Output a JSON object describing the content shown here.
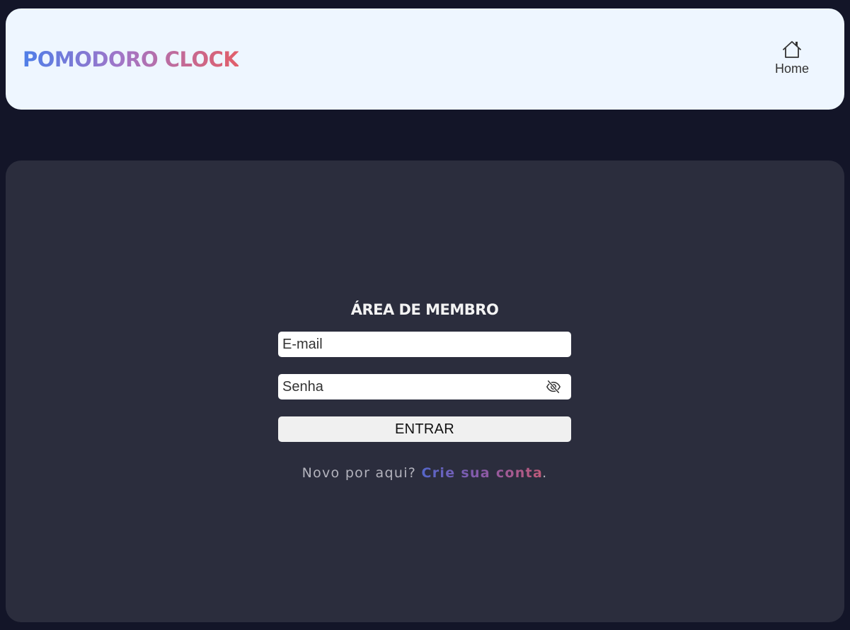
{
  "header": {
    "logo_text": "POMODORO CLOCK",
    "nav": {
      "home_label": "Home",
      "home_icon": "home-icon"
    }
  },
  "login": {
    "title": "ÁREA DE MEMBRO",
    "email_placeholder": "E-mail",
    "password_placeholder": "Senha",
    "password_toggle_icon": "eye-off-icon",
    "submit_label": "ENTRAR",
    "signup_prompt": "Novo por aqui?",
    "signup_link": "Crie sua conta",
    "signup_suffix": "."
  },
  "colors": {
    "page_background": "#131528",
    "header_background": "#eef6ff",
    "card_background": "#2b2d3d",
    "logo_gradient": [
      "#4e7ee8",
      "#a176c8",
      "#e15f6a"
    ]
  }
}
